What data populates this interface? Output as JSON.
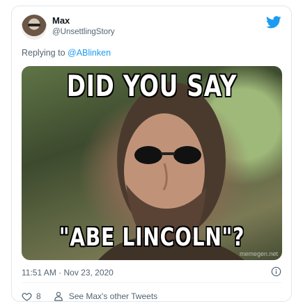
{
  "tweet": {
    "author_name": "Max",
    "author_handle": "@UnsettlingStory",
    "reply_prefix": "Replying to ",
    "reply_to": "@ABlinken",
    "timestamp": "11:51 AM · Nov 23, 2020",
    "like_count": "8",
    "other_tweets_label": "See Max's other Tweets"
  },
  "media": {
    "top_text": "DID YOU SAY",
    "bottom_text": "\"ABE LINCOLN\"?",
    "watermark": "memegen.net"
  },
  "colors": {
    "brand_blue": "#1d9bf0",
    "secondary_text": "#536471",
    "border": "#e1e8ed"
  },
  "icons": [
    "twitter-logo-icon",
    "info-icon",
    "heart-icon",
    "person-icon"
  ]
}
